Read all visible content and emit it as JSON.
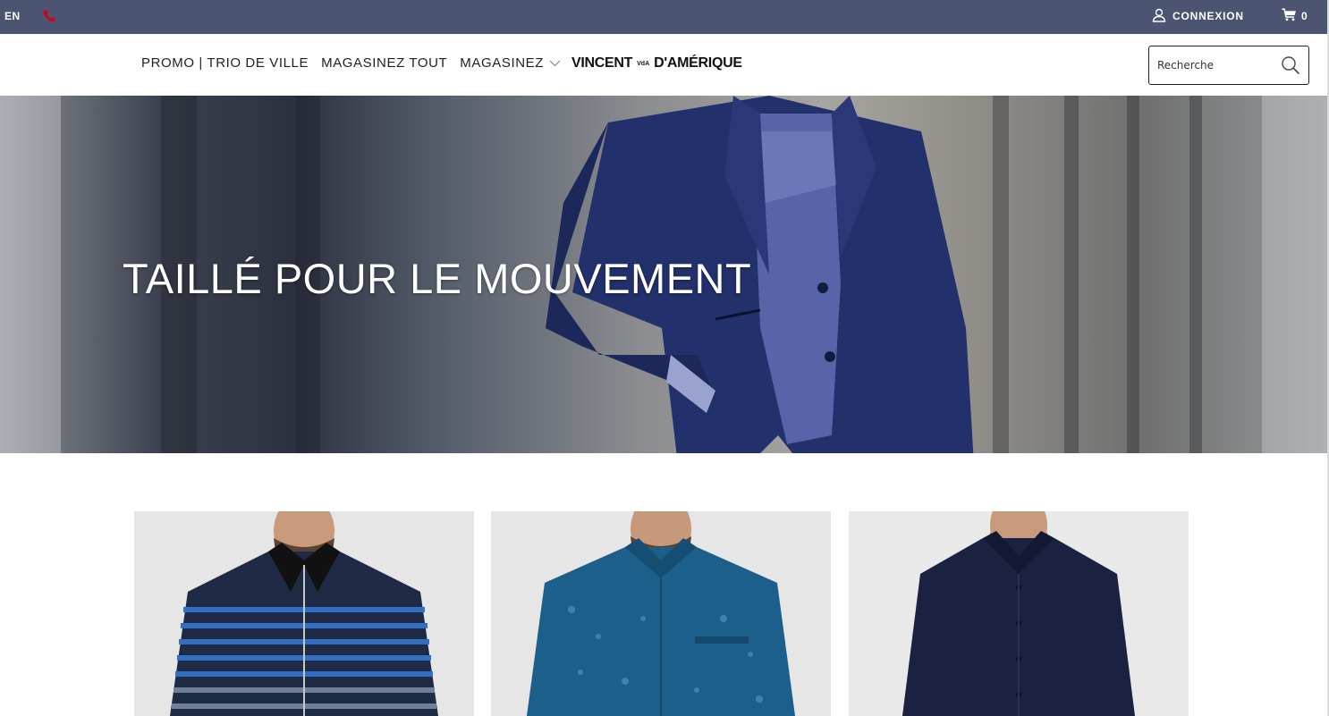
{
  "topbar": {
    "language": "EN",
    "login_label": "CONNEXION",
    "cart_count": "0"
  },
  "nav": {
    "items": [
      {
        "label": "PROMO | TRIO DE VILLE"
      },
      {
        "label": "MAGASINEZ TOUT"
      },
      {
        "label": "MAGASINEZ"
      }
    ]
  },
  "logo": {
    "left": "VINCENT",
    "mark": "VdA",
    "right": "D'AMÉRIQUE"
  },
  "search": {
    "placeholder": "Recherche"
  },
  "hero": {
    "title": "TAILLÉ POUR LE MOUVEMENT"
  },
  "products": [
    {
      "name": "striped-quarter-zip-sweater",
      "main_color": "#1f2a44",
      "accent_color": "#2f6fc4"
    },
    {
      "name": "teal-patterned-shirt",
      "main_color": "#1c5f8a",
      "accent_color": "#5aa0c8"
    },
    {
      "name": "navy-dress-shirt",
      "main_color": "#1b2140",
      "accent_color": "#2a3157"
    }
  ],
  "colors": {
    "topbar": "#4b5572",
    "phone_icon": "#d0021b",
    "hero_text": "#ffffff"
  }
}
